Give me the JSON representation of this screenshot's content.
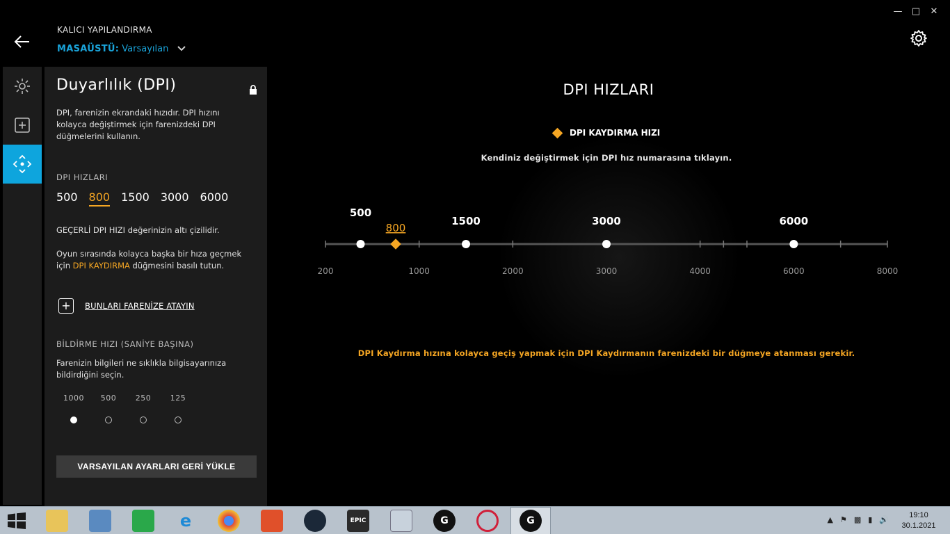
{
  "header": {
    "title": "KALICI YAPILANDIRMA",
    "profile_prefix": "MASAÜSTÜ:",
    "profile_name": "Varsayılan"
  },
  "panel": {
    "title": "Duyarlılık (DPI)",
    "description": "DPI, farenizin ekrandaki hızıdır. DPI hızını kolayca değiştirmek için farenizdeki DPI düğmelerini kullanın.",
    "dpi_heading": "DPI HIZLARI",
    "dpi_values": [
      "500",
      "800",
      "1500",
      "3000",
      "6000"
    ],
    "current_dpi": "800",
    "current_note": "GEÇERLİ DPI HIZI değerinizin altı çizilidir.",
    "shift_note_1": "Oyun sırasında kolayca başka bir hıza geçmek için",
    "shift_note_key": "DPI KAYDIRMA",
    "shift_note_2": "düğmesini basılı tutun.",
    "assign_label": "BUNLARI FARENİZE ATAYIN",
    "report_heading": "BİLDİRME HIZI (SANİYE BAŞINA)",
    "report_desc": "Farenizin bilgileri ne sıklıkla bilgisayarınıza bildirdiğini seçin.",
    "report_rates": [
      "1000",
      "500",
      "250",
      "125"
    ],
    "report_selected": "1000",
    "reset_label": "VARSAYILAN AYARLARI GERİ YÜKLE"
  },
  "main": {
    "title": "DPI HIZLARI",
    "legend_label": "DPI KAYDIRMA HIZI",
    "hint": "Kendiniz değiştirmek için DPI hız numarasına tıklayın.",
    "warning": "DPI Kaydırma hızına kolayca geçiş yapmak için DPI Kaydırmanın farenizdeki bir düğmeye atanması gerekir."
  },
  "slider": {
    "min": 200,
    "max": 8000,
    "axis_labels": [
      200,
      1000,
      2000,
      3000,
      4000,
      6000,
      8000
    ],
    "ticks": [
      200,
      1000,
      1500,
      2000,
      3000,
      4000,
      4500,
      5000,
      6000,
      7000,
      8000
    ],
    "points": [
      {
        "label": "500",
        "value": 500
      },
      {
        "label": "1500",
        "value": 1500
      },
      {
        "label": "3000",
        "value": 3000
      },
      {
        "label": "6000",
        "value": 6000
      }
    ],
    "shift_point": {
      "label": "800",
      "value": 800
    }
  },
  "taskbar": {
    "time": "19:10",
    "date": "30.1.2021",
    "apps": [
      "file-explorer",
      "control-panel",
      "store",
      "internet-explorer",
      "chrome",
      "office",
      "steam",
      "epic-games",
      "task-manager",
      "logitech-g-hub",
      "opera",
      "logitech-g-hub-active"
    ]
  },
  "colors": {
    "accent_blue": "#0ea5dd",
    "accent_orange": "#f5a623",
    "panel_bg": "#1c1c1c"
  }
}
